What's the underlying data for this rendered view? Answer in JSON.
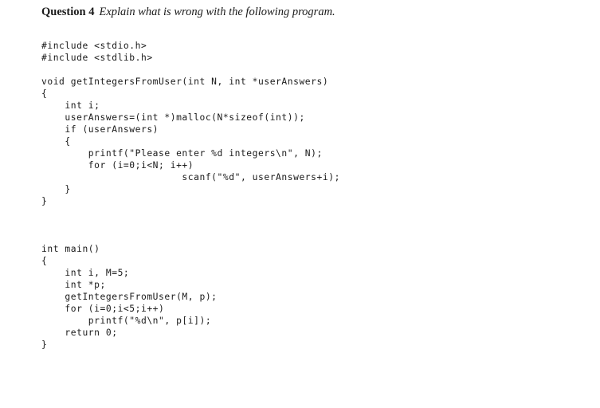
{
  "document": {
    "heading": {
      "label": "Question 4",
      "prompt": "Explain what is wrong with the following program."
    },
    "code": {
      "language": "c",
      "lines": [
        "#include <stdio.h>",
        "#include <stdlib.h>",
        "",
        "void getIntegersFromUser(int N, int *userAnswers)",
        "{",
        "    int i;",
        "    userAnswers=(int *)malloc(N*sizeof(int));",
        "    if (userAnswers)",
        "    {",
        "        printf(\"Please enter %d integers\\n\", N);",
        "        for (i=0;i<N; i++)",
        "                        scanf(\"%d\", userAnswers+i);",
        "    }",
        "}",
        "",
        "",
        "",
        "int main()",
        "{",
        "    int i, M=5;",
        "    int *p;",
        "    getIntegersFromUser(M, p);",
        "    for (i=0;i<5;i++)",
        "        printf(\"%d\\n\", p[i]);",
        "    return 0;",
        "}"
      ]
    }
  }
}
